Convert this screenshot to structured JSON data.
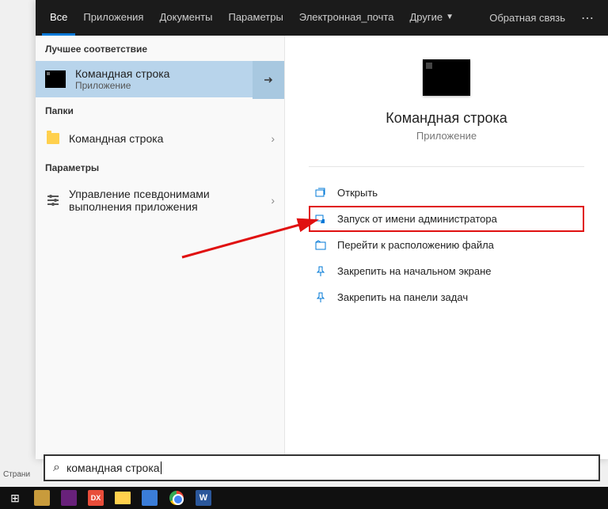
{
  "tabs": {
    "all": "Все",
    "apps": "Приложения",
    "docs": "Документы",
    "params": "Параметры",
    "email": "Электронная_почта",
    "other": "Другие",
    "feedback": "Обратная связь"
  },
  "sections": {
    "best_match": "Лучшее соответствие",
    "folders": "Папки",
    "settings": "Параметры"
  },
  "best_match": {
    "title": "Командная строка",
    "subtitle": "Приложение"
  },
  "folders_item": "Командная строка",
  "settings_item": "Управление псевдонимами выполнения приложения",
  "preview": {
    "title": "Командная строка",
    "subtitle": "Приложение"
  },
  "actions": {
    "open": "Открыть",
    "run_admin": "Запуск от имени администратора",
    "go_location": "Перейти к расположению файла",
    "pin_start": "Закрепить на начальном экране",
    "pin_taskbar": "Закрепить на панели задач"
  },
  "search": {
    "query": "командная строка"
  },
  "page_label": "Страни",
  "taskbar": {
    "dx": "DX",
    "word": "W"
  }
}
